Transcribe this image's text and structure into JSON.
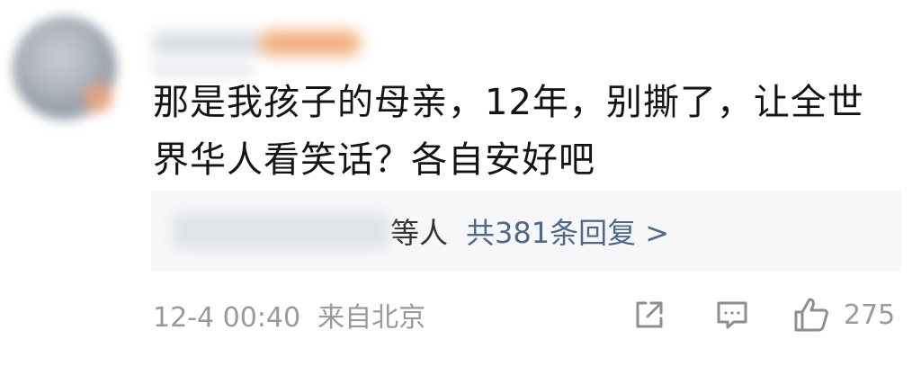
{
  "comment": {
    "text": "那是我孩子的母亲，12年，别撕了，让全世界华人看笑话？各自安好吧"
  },
  "replies": {
    "who_suffix": "等人",
    "count_label": "共381条回复 >"
  },
  "meta": {
    "time": "12-4 00:40",
    "location": "来自北京"
  },
  "actions": {
    "likes": "275"
  },
  "icons": {
    "share": "share-icon",
    "comment": "comment-icon",
    "like": "thumbs-up-icon"
  },
  "colors": {
    "link": "#51678a",
    "meta": "#9a9a9a",
    "reply_bg": "#f6f7f9"
  }
}
